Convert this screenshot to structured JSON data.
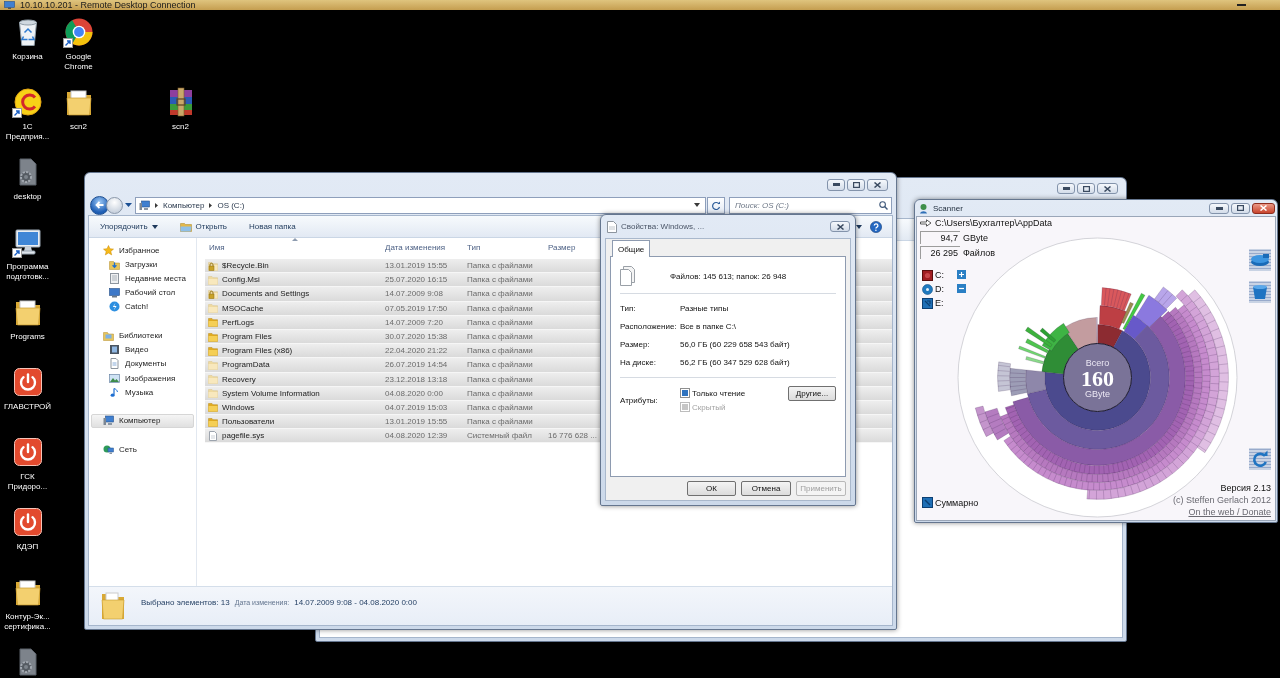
{
  "remote_desktop": {
    "title": "10.10.10.201 - Remote Desktop Connection"
  },
  "desktop_icons": [
    {
      "label": "Корзина",
      "kind": "recycle-bin",
      "shortcut": false
    },
    {
      "label": "Google Chrome",
      "kind": "chrome",
      "shortcut": true
    },
    {
      "label": "1С Предприя...",
      "kind": "onec",
      "shortcut": true
    },
    {
      "label": "scn2",
      "kind": "folder",
      "shortcut": false
    },
    {
      "label": "scn2",
      "kind": "archive",
      "shortcut": false
    },
    {
      "label": "desktop",
      "kind": "gear-file",
      "shortcut": false
    },
    {
      "label": "Программа подготовк...",
      "kind": "computer",
      "shortcut": true
    },
    {
      "label": "Programs",
      "kind": "folder",
      "shortcut": false
    },
    {
      "label": "ГЛАВСТРОЙ",
      "kind": "power",
      "shortcut": false
    },
    {
      "label": "ГСК Придоро...",
      "kind": "power",
      "shortcut": false
    },
    {
      "label": "КДЭП",
      "kind": "power",
      "shortcut": false
    },
    {
      "label": "Контур-Эк... сертифика...",
      "kind": "folder",
      "shortcut": false
    },
    {
      "kind": "gear-file",
      "shortcut": false
    }
  ],
  "explorer": {
    "active": false,
    "breadcrumb": [
      "Компьютер",
      "OS (C:)"
    ],
    "search": {
      "placeholder": "Поиск: OS (C:)"
    },
    "toolbar": [
      {
        "label": "Упорядочить",
        "kind": "menu"
      },
      {
        "label": "Открыть",
        "kind": "open"
      },
      {
        "label": "Новая папка",
        "kind": "plain"
      }
    ],
    "navigation": [
      {
        "label": "Избранное",
        "kind": "star",
        "selected": false,
        "children": [
          {
            "label": "Загрузки",
            "kind": "downloads",
            "selected": false
          },
          {
            "label": "Недавние места",
            "kind": "recent",
            "selected": false
          },
          {
            "label": "Рабочий стол",
            "kind": "desktop",
            "selected": false
          },
          {
            "label": "Catch!",
            "kind": "catch",
            "selected": false
          }
        ]
      },
      {
        "label": "Библиотеки",
        "kind": "libraries",
        "selected": false,
        "children": [
          {
            "label": "Видео",
            "kind": "video",
            "selected": false
          },
          {
            "label": "Документы",
            "kind": "documents",
            "selected": false
          },
          {
            "label": "Изображения",
            "kind": "pictures",
            "selected": false
          },
          {
            "label": "Музыка",
            "kind": "music",
            "selected": false
          }
        ]
      },
      {
        "label": "Компьютер",
        "kind": "computer",
        "selected": true
      },
      {
        "label": "Сеть",
        "kind": "network",
        "selected": false
      }
    ],
    "columns": [
      {
        "label": "Имя",
        "sorted": true
      },
      {
        "label": "Дата изменения",
        "sorted": false
      },
      {
        "label": "Тип",
        "sorted": false
      },
      {
        "label": "Размер",
        "sorted": false
      }
    ],
    "rows": [
      {
        "name": "$Recycle.Bin",
        "date": "13.01.2019 15:55",
        "type": "Папка с файлами",
        "kind": "locked-folder",
        "selected": true
      },
      {
        "name": "Config.Msi",
        "date": "25.07.2020 16:15",
        "type": "Папка с файлами",
        "kind": "hidden-folder",
        "selected": true
      },
      {
        "name": "Documents and Settings",
        "date": "14.07.2009 9:08",
        "type": "Папка с файлами",
        "kind": "locked-folder",
        "selected": true
      },
      {
        "name": "MSOCache",
        "date": "07.05.2019 17:50",
        "type": "Папка с файлами",
        "kind": "hidden-folder",
        "selected": true
      },
      {
        "name": "PerfLogs",
        "date": "14.07.2009 7:20",
        "type": "Папка с файлами",
        "kind": "folder",
        "selected": true
      },
      {
        "name": "Program Files",
        "date": "30.07.2020 15:38",
        "type": "Папка с файлами",
        "kind": "folder",
        "selected": true
      },
      {
        "name": "Program Files (x86)",
        "date": "22.04.2020 21:22",
        "type": "Папка с файлами",
        "kind": "folder",
        "selected": true
      },
      {
        "name": "ProgramData",
        "date": "26.07.2019 14:54",
        "type": "Папка с файлами",
        "kind": "hidden-folder",
        "selected": true
      },
      {
        "name": "Recovery",
        "date": "23.12.2018 13:18",
        "type": "Папка с файлами",
        "kind": "hidden-folder",
        "selected": true
      },
      {
        "name": "System Volume Information",
        "date": "04.08.2020 0:00",
        "type": "Папка с файлами",
        "kind": "hidden-folder",
        "selected": true
      },
      {
        "name": "Windows",
        "date": "04.07.2019 15:03",
        "type": "Папка с файлами",
        "kind": "folder",
        "selected": true
      },
      {
        "name": "Пользователи",
        "date": "13.01.2019 15:55",
        "type": "Папка с файлами",
        "kind": "folder",
        "selected": true
      },
      {
        "name": "pagefile.sys",
        "date": "04.08.2020 12:39",
        "type": "Системный файл",
        "size": "16 776 628 ...",
        "kind": "file",
        "selected": true
      }
    ],
    "status": {
      "selection": "Выбрано элементов: 13",
      "date_label": "Дата изменения:",
      "date_range": "14.07.2009 9:08 - 04.08.2020 0:00"
    }
  },
  "properties": {
    "active": false,
    "title": "Свойства: Windows, ...",
    "tabs": [
      {
        "label": "Общие",
        "selected": true
      }
    ],
    "summary": "Файлов: 145 613; папок: 26 948",
    "details": [
      {
        "label": "Тип:",
        "value": "Разные типы"
      },
      {
        "label": "Расположение:",
        "value": "Все в папке C:\\"
      },
      {
        "label": "Размер:",
        "value": "56,0 ГБ (60 229 658 543 байт)"
      },
      {
        "label": "На диске:",
        "value": "56,2 ГБ (60 347 529 628 байт)"
      }
    ],
    "attributes_label": "Атрибуты:",
    "attributes": [
      {
        "label": "Только чтение",
        "indeterminate": true,
        "disabled": false
      },
      {
        "label": "Скрытый",
        "indeterminate": true,
        "disabled": true
      }
    ],
    "advanced_button": "Другие...",
    "buttons": [
      {
        "label": "ОК",
        "disabled": false
      },
      {
        "label": "Отмена",
        "disabled": false
      },
      {
        "label": "Применить",
        "disabled": true
      }
    ]
  },
  "scanner": {
    "active": true,
    "title": "Scanner",
    "path": "C:\\Users\\Бухгалтер\\AppData",
    "stats": [
      {
        "value": "94,7",
        "unit": "GByte"
      },
      {
        "value": "26 295",
        "unit": "Файлов"
      }
    ],
    "drives": [
      {
        "label": "C:",
        "kind": "hdd"
      },
      {
        "label": "D:",
        "kind": "disc"
      },
      {
        "label": "E:",
        "kind": "removable"
      }
    ],
    "total": {
      "caption": "Всего",
      "value": "160",
      "unit": "GByte"
    },
    "version": "Версия 2.13",
    "copyright": "(c) Steffen Gerlach 2012",
    "link": "On the web / Donate",
    "summary": "Суммарно"
  }
}
